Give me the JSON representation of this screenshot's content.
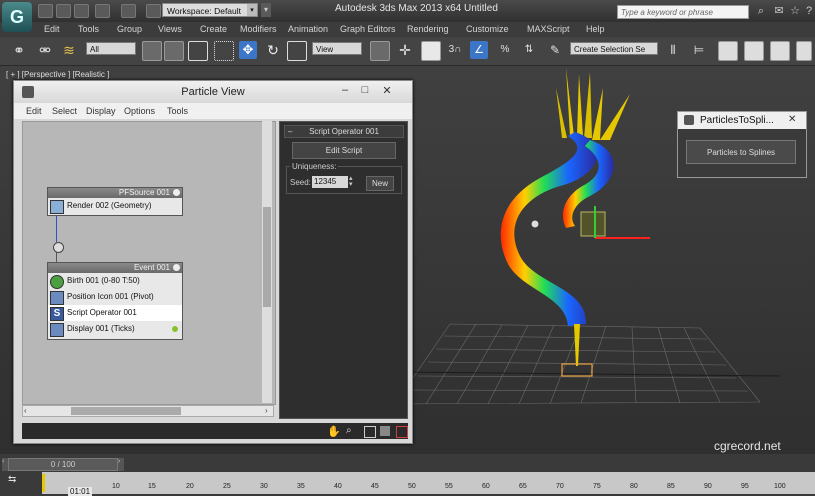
{
  "titlebar": {
    "workspace": "Workspace: Default",
    "title": "Autodesk 3ds Max  2013 x64        Untitled",
    "search_placeholder": "Type a keyword or phrase"
  },
  "menu": [
    "Edit",
    "Tools",
    "Group",
    "Views",
    "Create",
    "Modifiers",
    "Animation",
    "Graph Editors",
    "Rendering",
    "Customize",
    "MAXScript",
    "Help"
  ],
  "toolbar": {
    "selection_filter": "All",
    "ref_coord": "View",
    "named_selection": "Create Selection Se"
  },
  "viewport": {
    "label": "[ + ] [Perspective ] [Realistic ]"
  },
  "particle_view": {
    "title": "Particle View",
    "menu": [
      "Edit",
      "Select",
      "Display",
      "Options",
      "Tools"
    ],
    "source_node": {
      "title": "PFSource 001",
      "row": "Render 002 (Geometry)"
    },
    "event_node": {
      "title": "Event 001",
      "rows": [
        "Birth 001 (0-80 T:50)",
        "Position Icon 001 (Pivot)",
        "Script Operator 001",
        "Display 001 (Ticks)"
      ]
    },
    "params": {
      "rollout_title": "Script Operator 001",
      "edit_button": "Edit Script",
      "group_label": "Uniqueness:",
      "seed_label": "Seed:",
      "seed_value": "12345",
      "new_button": "New"
    }
  },
  "p2s": {
    "title": "ParticlesToSpli...",
    "button": "Particles to Splines"
  },
  "timeline": {
    "slider": "0 / 100",
    "ticks": [
      "10",
      "15",
      "20",
      "25",
      "30",
      "35",
      "40",
      "45",
      "50",
      "55",
      "60",
      "65",
      "70",
      "75",
      "80",
      "85",
      "90",
      "95",
      "100"
    ],
    "readout": "01:01"
  },
  "watermark": "cgrecord.net"
}
